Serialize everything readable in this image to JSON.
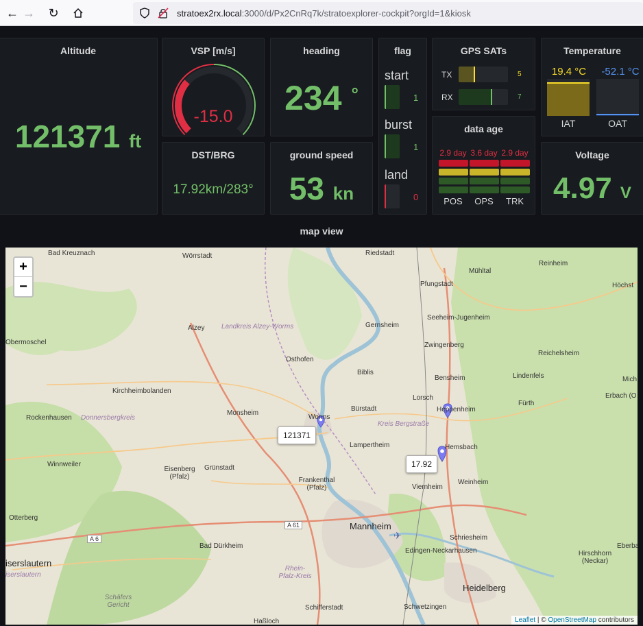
{
  "browser": {
    "url_host": "stratoex2rx.local",
    "url_path": ":3000/d/Px2CnRq7k/stratoexplorer-cockpit?orgId=1&kiosk"
  },
  "altitude": {
    "title": "Altitude",
    "value": "121371",
    "unit": "ft"
  },
  "vsp": {
    "title": "VSP [m/s]",
    "value": "-15.0",
    "gauge_fraction": 0.32
  },
  "heading": {
    "title": "heading",
    "value": "234",
    "unit": "°"
  },
  "flag": {
    "title": "flag",
    "items": [
      {
        "label": "start",
        "value": "1"
      },
      {
        "label": "burst",
        "value": "1"
      },
      {
        "label": "land",
        "value": "0"
      }
    ]
  },
  "gps": {
    "title": "GPS SATs",
    "rows": [
      {
        "label": "TX",
        "value": "5",
        "fraction": 0.33
      },
      {
        "label": "RX",
        "value": "7",
        "fraction": 0.68
      }
    ]
  },
  "temperature": {
    "title": "Temperature",
    "iat": {
      "label": "IAT",
      "value": "19.4 °C",
      "fraction": 0.9
    },
    "oat": {
      "label": "OAT",
      "value": "-52.1 °C",
      "fraction": 0.05
    }
  },
  "dst": {
    "title": "DST/BRG",
    "value": "17.92km/283°"
  },
  "ground_speed": {
    "title": "ground speed",
    "value": "53",
    "unit": "kn"
  },
  "data_age": {
    "title": "data age",
    "columns": [
      {
        "label": "POS",
        "value": "2.9 day"
      },
      {
        "label": "OPS",
        "value": "3.6 day"
      },
      {
        "label": "TRK",
        "value": "2.9 day"
      }
    ]
  },
  "voltage": {
    "title": "Voltage",
    "value": "4.97",
    "unit": "V"
  },
  "map_view": {
    "title": "map view",
    "zoom_in": "+",
    "zoom_out": "−",
    "marker1_label": "121371",
    "marker2_label": "17.92",
    "places": [
      "Bad Kreuznach",
      "Wörrstadt",
      "Riedstadt",
      "Mühltal",
      "Reinheim",
      "Höchst",
      "Pfungstadt",
      "Seeheim-Jugenheim",
      "Gernsheim",
      "Zwingenberg",
      "Reichelsheim",
      "Alzey",
      "Landkreis Alzey-Worms",
      "Obermoschel",
      "Osthofen",
      "Biblis",
      "Bensheim",
      "Lindenfels",
      "Kirchheimbolanden",
      "Lorsch",
      "Heppenheim",
      "Fürth",
      "Erbach (O",
      "Mich",
      "Rockenhausen",
      "Donnersbergkreis",
      "Monsheim",
      "Worms",
      "Bürstadt",
      "Kreis Bergstraße",
      "Lampertheim",
      "Hemsbach",
      "Winnweiler",
      "Eisenberg (Pfalz)",
      "Grünstadt",
      "Frankenthal (Pfalz)",
      "Viernheim",
      "Weinheim",
      "Otterberg",
      "A 6",
      "A 61",
      "Mannheim",
      "Schriesheim",
      "Edingen-Neckarhausen",
      "Bad Dürkheim",
      "Hirschhorn (Neckar)",
      "Eberba",
      "iserslautern",
      "iserslautern",
      "Rhein-Pfalz-Kreis",
      "Heidelberg",
      "Schäfers Gericht",
      "Schifferstadt",
      "Schwetzingen",
      "Haßloch"
    ],
    "attribution_leaflet": "Leaflet",
    "attribution_sep": " | © ",
    "attribution_osm": "OpenStreetMap",
    "attribution_tail": " contributors"
  },
  "colors": {
    "green": "#73bf69",
    "red": "#e02f44",
    "yellow": "#fade2a",
    "blue": "#5794f2"
  }
}
